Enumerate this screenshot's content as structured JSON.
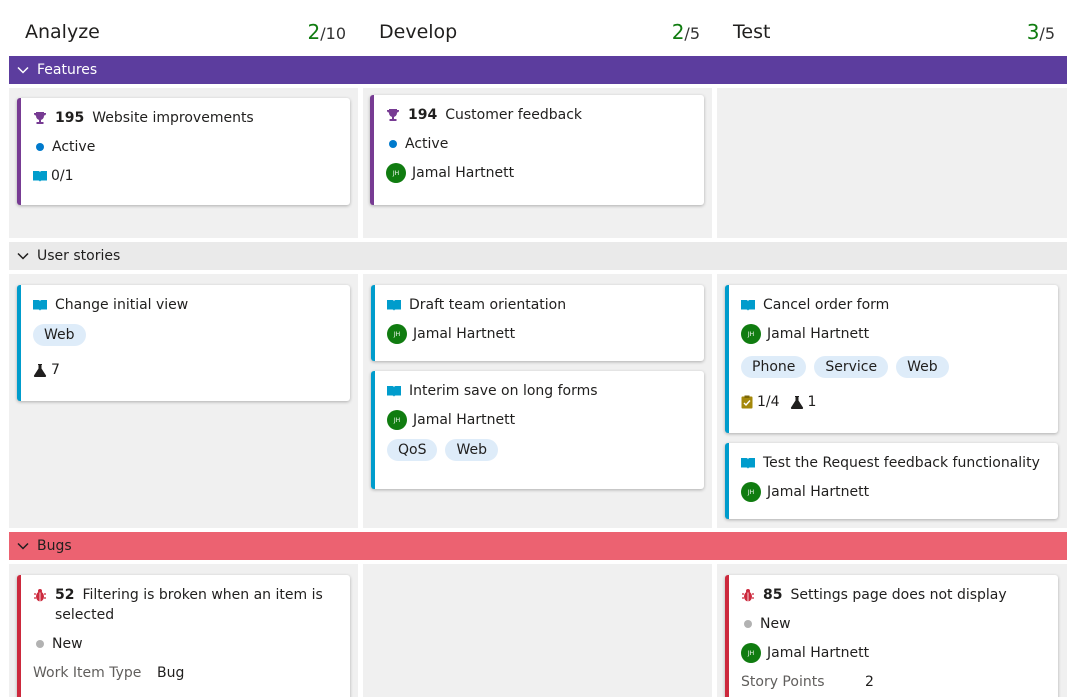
{
  "columns": [
    {
      "title": "Analyze",
      "count": "2",
      "limit": "/10"
    },
    {
      "title": "Develop",
      "count": "2",
      "limit": "/5"
    },
    {
      "title": "Test",
      "count": "3",
      "limit": "/5"
    }
  ],
  "lanes": {
    "features": "Features",
    "stories": "User stories",
    "bugs": "Bugs"
  },
  "cards": {
    "f195": {
      "id": "195",
      "title": "Website improvements",
      "state": "Active",
      "progress": "0/1"
    },
    "f194": {
      "id": "194",
      "title": "Customer feedback",
      "state": "Active",
      "assignee": "Jamal Hartnett",
      "initials": "JH"
    },
    "s_change": {
      "title": "Change initial view",
      "tags": [
        "Web"
      ],
      "tests": "7"
    },
    "s_draft": {
      "title": "Draft team orientation",
      "assignee": "Jamal Hartnett",
      "initials": "JH"
    },
    "s_interim": {
      "title": "Interim save on long forms",
      "assignee": "Jamal Hartnett",
      "initials": "JH",
      "tags": [
        "QoS",
        "Web"
      ]
    },
    "s_cancel": {
      "title": "Cancel order form",
      "assignee": "Jamal Hartnett",
      "initials": "JH",
      "tags": [
        "Phone",
        "Service",
        "Web"
      ],
      "tasks": "1/4",
      "tests": "1"
    },
    "s_request": {
      "title": "Test the Request feedback functionality",
      "assignee": "Jamal Hartnett",
      "initials": "JH"
    },
    "b52": {
      "id": "52",
      "title": "Filtering is broken when an item is selected",
      "state": "New",
      "field_label": "Work Item Type",
      "field_value": "Bug"
    },
    "b85": {
      "id": "85",
      "title": "Settings page does not display",
      "state": "New",
      "assignee": "Jamal Hartnett",
      "initials": "JH",
      "field_label": "Story Points",
      "field_value": "2"
    }
  },
  "colors": {
    "feature_lane": "#5c3d9e",
    "bug_lane": "#ec6271",
    "count_green": "#107c10",
    "active_dot": "#007acc",
    "new_dot": "#b2b2b2"
  }
}
